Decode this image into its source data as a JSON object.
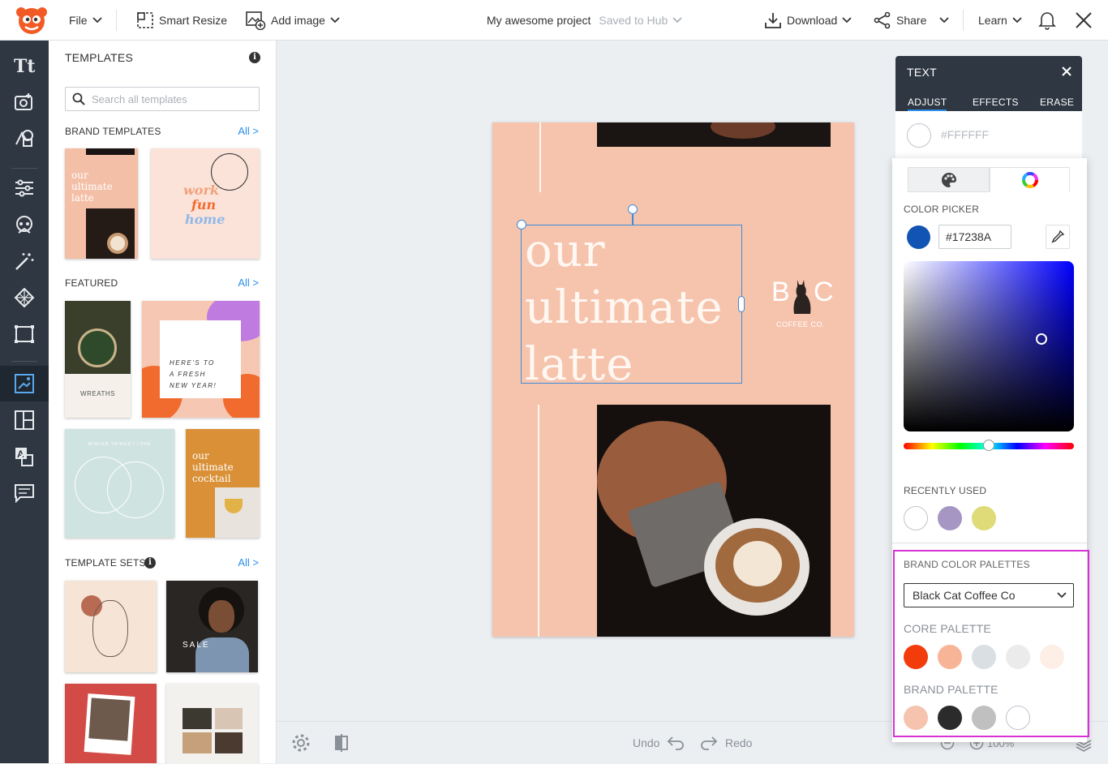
{
  "topbar": {
    "file": "File",
    "smart_resize": "Smart Resize",
    "add_image": "Add image",
    "project_name": "My awesome project",
    "save_status": "Saved to Hub",
    "download": "Download",
    "share": "Share",
    "learn": "Learn"
  },
  "templates": {
    "title": "TEMPLATES",
    "search_placeholder": "Search all templates",
    "brand_templates": "BRAND TEMPLATES",
    "featured": "FEATURED",
    "template_sets": "TEMPLATE SETS",
    "all_link": "All >",
    "thumb_texts": {
      "brand1": "our\nultimate\nlatte",
      "brand2_line1": "work",
      "brand2_line2": "fun",
      "brand2_line3": "home",
      "featured1": "WREATHS",
      "featured2": "HERE'S TO\nA FRESH\nNEW YEAR!",
      "featured3": "WINTER THINGS I LOVE",
      "featured4": "our\nultimate\ncocktail",
      "set2": "SALE"
    }
  },
  "canvas": {
    "headline": "our\nultimate\nlatte",
    "brand_b": "B",
    "brand_c": "C",
    "brand_sub": "COFFEE CO."
  },
  "bottombar": {
    "undo": "Undo",
    "redo": "Redo",
    "zoom": "100%"
  },
  "text_panel": {
    "title": "TEXT",
    "tabs": [
      "ADJUST",
      "EFFECTS",
      "ERASE"
    ],
    "current_hex": "#FFFFFF"
  },
  "color_panel": {
    "color_picker_label": "COLOR PICKER",
    "hex_value": "#17238A",
    "recently_used_label": "RECENTLY USED",
    "recently_used": [
      "#ffffff",
      "#a596c4",
      "#dedb78"
    ],
    "brand_palettes_label": "BRAND COLOR PALETTES",
    "palette_selected": "Black Cat Coffee Co",
    "core_palette_label": "CORE PALETTE",
    "core_palette": [
      "#f23c0c",
      "#f8b497",
      "#d9dfe2",
      "#ebebeb",
      "#fdeee6"
    ],
    "brand_palette_label": "BRAND PALETTE",
    "brand_palette": [
      "#f6c3ae",
      "#2b2b2b",
      "#c0c0c0",
      "#ffffff"
    ],
    "selected_swatch": "#1254b3"
  },
  "colors": {
    "accent": "#2a8ee8",
    "rail": "#2e3742",
    "design_bg": "#f6c4ad",
    "highlight": "#d633d6"
  }
}
